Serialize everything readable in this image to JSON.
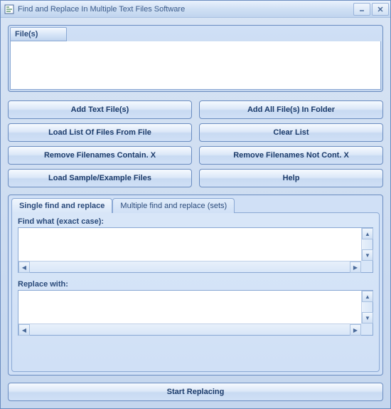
{
  "window": {
    "title": "Find and Replace In Multiple Text Files Software"
  },
  "files": {
    "header": "File(s)"
  },
  "buttons": {
    "add_files": "Add Text File(s)",
    "add_folder": "Add All File(s) In Folder",
    "load_list": "Load List Of Files From File",
    "clear_list": "Clear List",
    "remove_contain": "Remove Filenames Contain. X",
    "remove_not_contain": "Remove Filenames Not Cont. X",
    "load_sample": "Load Sample/Example Files",
    "help": "Help"
  },
  "tabs": {
    "single": "Single find and replace",
    "multiple": "Multiple find and replace (sets)"
  },
  "fields": {
    "find_label": "Find what (exact case):",
    "replace_label": "Replace with:"
  },
  "action": {
    "start": "Start Replacing"
  }
}
